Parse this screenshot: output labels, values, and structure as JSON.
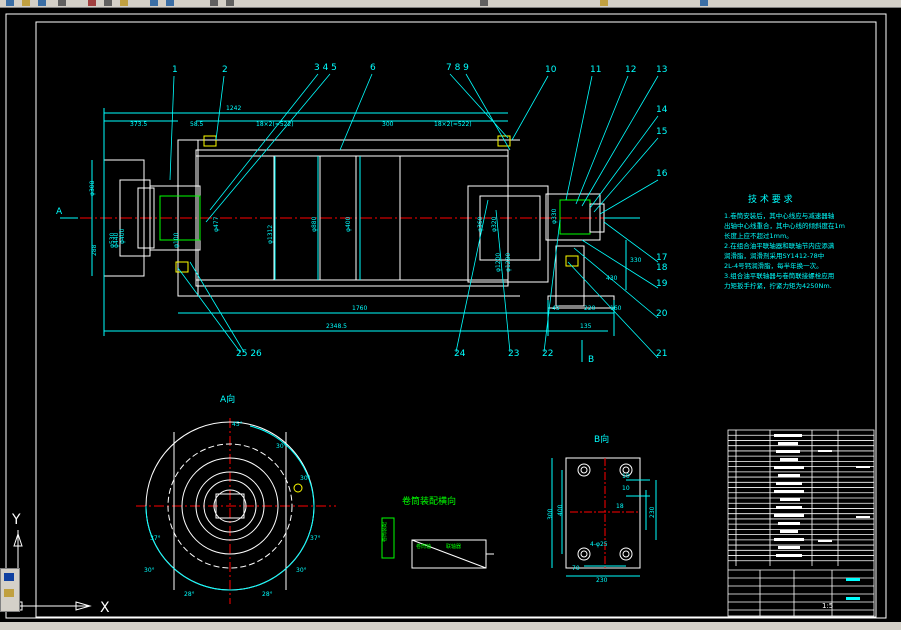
{
  "toolbar": {
    "icons": [
      "new-icon",
      "open-icon",
      "save-icon",
      "print-icon",
      "cut-icon",
      "copy-icon",
      "paste-icon",
      "undo-icon",
      "redo-icon",
      "pan-icon",
      "zoom-icon",
      "properties-icon",
      "layer-icon",
      "help-icon"
    ]
  },
  "colors": {
    "background": "#000000",
    "frame": "#ffffff",
    "outline": "#ffffff",
    "dimension": "#00ffff",
    "centerline": "#ff0000",
    "text": "#00ffff",
    "note": "#00ffff",
    "leader": "#00ffff",
    "yellow": "#ffff00",
    "green": "#00ff00"
  },
  "balloons": [
    "1",
    "2",
    "3 4 5",
    "6",
    "7 8 9",
    "10",
    "11",
    "12",
    "13",
    "14",
    "15",
    "16",
    "17",
    "18",
    "19",
    "20",
    "21",
    "22",
    "23",
    "24",
    "25 26"
  ],
  "dims": {
    "d1242": "1242",
    "d3735": "373.5",
    "d585": "58.5",
    "d18x2a": "18×2(≈522)",
    "d300": "300",
    "d18x2b": "18×2(≈522)",
    "d1760": "1760",
    "d2348": "2348.5",
    "d45": "45",
    "d220": "220",
    "d135": "135",
    "d160": "160",
    "d330": "330",
    "d430": "430",
    "dv1": "φ308",
    "dv2": "φ530",
    "dv3": "φ400",
    "dv4": "φ1312",
    "dv5": "φ880",
    "dv6": "φ477",
    "dv7": "φ400",
    "dv8": "288",
    "dv9": "φ360",
    "dv10": "φ320",
    "dv11": "φ1200",
    "dv12": "φ1280",
    "dv13": "φ330",
    "dv14": "φ100",
    "dv15": "φ440"
  },
  "section_labels": {
    "a_mark": "A",
    "b_mark": "B",
    "a_view": "A向",
    "b_view": "B向"
  },
  "notes": {
    "title": "技 术 要 求",
    "lines": [
      "1.卷筒安装后，其中心线应与减速器轴",
      "  出轴中心线重合，其中心线的倾斜度在1m",
      "  长度上应不超过1mm。",
      "2.在组合油平联轴器和联轴节内应添满",
      "  润滑脂，润滑剂采用SY1412-78中",
      "  2L-4号钙润滑脂，每半年换一次。",
      "3.组合油平联轴器与卷筒联接螺栓应用",
      "  力矩扳手拧紧，拧紧力矩为4250Nm."
    ]
  },
  "aview": {
    "angles": [
      "45°",
      "30°",
      "30°",
      "37°",
      "37°",
      "30°",
      "30°",
      "28°",
      "28°"
    ]
  },
  "bview": {
    "dims": [
      "10",
      "10",
      "18",
      "300",
      "400",
      "230",
      "4-φ25",
      "70",
      "230"
    ]
  },
  "assembly": {
    "title": "卷筒装配横向",
    "labels": [
      "卷筒装配",
      "卷筒轴",
      "联轴器"
    ]
  },
  "titleblock": {
    "scale": "1:5",
    "rows": 26
  },
  "ucs": {
    "x": "X",
    "y": "Y"
  }
}
